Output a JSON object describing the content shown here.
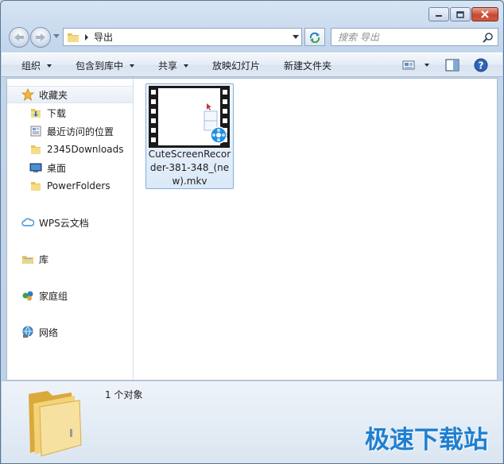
{
  "window": {
    "caption_buttons": [
      "minimize",
      "maximize",
      "close"
    ]
  },
  "address": {
    "path": "导出"
  },
  "search": {
    "placeholder": "搜索 导出"
  },
  "toolbar": {
    "organize": "组织",
    "include_in_library": "包含到库中",
    "share": "共享",
    "slideshow": "放映幻灯片",
    "new_folder": "新建文件夹"
  },
  "nav": {
    "favorites": "收藏夹",
    "favorite_items": [
      "下载",
      "最近访问的位置",
      "2345Downloads",
      "桌面",
      "PowerFolders"
    ],
    "wps": "WPS云文档",
    "libraries": "库",
    "homegroup": "家庭组",
    "network": "网络"
  },
  "files": [
    {
      "name": "CuteScreenRecorder-381-348_(new).mkv"
    }
  ],
  "details": {
    "count": "1 个对象"
  },
  "watermark": "极速下载站",
  "colors": {
    "accent": "#1f7fd0",
    "selection_border": "#84acdd"
  }
}
